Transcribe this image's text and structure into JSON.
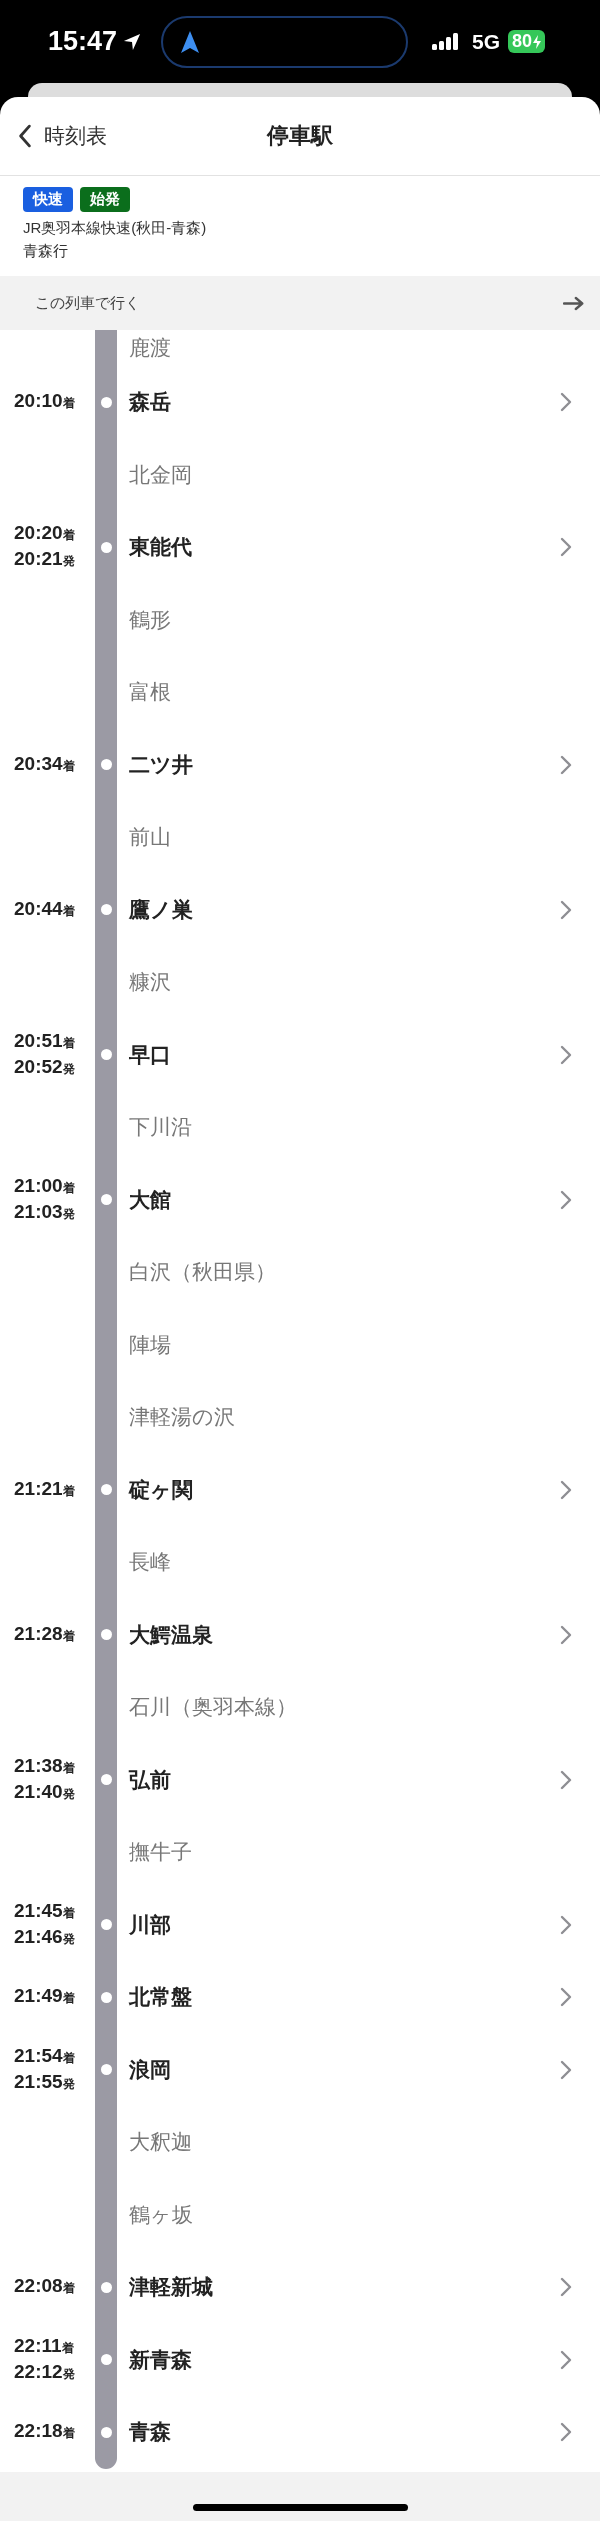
{
  "status_bar": {
    "time": "15:47",
    "network": "5G",
    "battery": "80"
  },
  "header": {
    "back_label": "時刻表",
    "title": "停車駅"
  },
  "train": {
    "badges": [
      {
        "label": "快速",
        "color": "#1a5fe0"
      },
      {
        "label": "始発",
        "color": "#0b6e1c"
      }
    ],
    "line": "JR奥羽本線快速(秋田-青森)",
    "destination": "青森行"
  },
  "ride_button": {
    "label": "この列車で行く"
  },
  "stops": [
    {
      "name": "鹿渡",
      "kind": "pass"
    },
    {
      "name": "森岳",
      "kind": "stop",
      "times": [
        {
          "time": "20:10",
          "type": "着"
        }
      ]
    },
    {
      "name": "北金岡",
      "kind": "pass"
    },
    {
      "name": "東能代",
      "kind": "stop",
      "times": [
        {
          "time": "20:20",
          "type": "着"
        },
        {
          "time": "20:21",
          "type": "発"
        }
      ]
    },
    {
      "name": "鶴形",
      "kind": "pass"
    },
    {
      "name": "富根",
      "kind": "pass"
    },
    {
      "name": "二ツ井",
      "kind": "stop",
      "times": [
        {
          "time": "20:34",
          "type": "着"
        }
      ]
    },
    {
      "name": "前山",
      "kind": "pass"
    },
    {
      "name": "鷹ノ巣",
      "kind": "stop",
      "times": [
        {
          "time": "20:44",
          "type": "着"
        }
      ]
    },
    {
      "name": "糠沢",
      "kind": "pass"
    },
    {
      "name": "早口",
      "kind": "stop",
      "times": [
        {
          "time": "20:51",
          "type": "着"
        },
        {
          "time": "20:52",
          "type": "発"
        }
      ]
    },
    {
      "name": "下川沿",
      "kind": "pass"
    },
    {
      "name": "大館",
      "kind": "stop",
      "times": [
        {
          "time": "21:00",
          "type": "着"
        },
        {
          "time": "21:03",
          "type": "発"
        }
      ]
    },
    {
      "name": "白沢（秋田県）",
      "kind": "pass"
    },
    {
      "name": "陣場",
      "kind": "pass"
    },
    {
      "name": "津軽湯の沢",
      "kind": "pass"
    },
    {
      "name": "碇ヶ関",
      "kind": "stop",
      "times": [
        {
          "time": "21:21",
          "type": "着"
        }
      ]
    },
    {
      "name": "長峰",
      "kind": "pass"
    },
    {
      "name": "大鰐温泉",
      "kind": "stop",
      "times": [
        {
          "time": "21:28",
          "type": "着"
        }
      ]
    },
    {
      "name": "石川（奥羽本線）",
      "kind": "pass"
    },
    {
      "name": "弘前",
      "kind": "stop",
      "times": [
        {
          "time": "21:38",
          "type": "着"
        },
        {
          "time": "21:40",
          "type": "発"
        }
      ]
    },
    {
      "name": "撫牛子",
      "kind": "pass"
    },
    {
      "name": "川部",
      "kind": "stop",
      "times": [
        {
          "time": "21:45",
          "type": "着"
        },
        {
          "time": "21:46",
          "type": "発"
        }
      ]
    },
    {
      "name": "北常盤",
      "kind": "stop",
      "times": [
        {
          "time": "21:49",
          "type": "着"
        }
      ]
    },
    {
      "name": "浪岡",
      "kind": "stop",
      "times": [
        {
          "time": "21:54",
          "type": "着"
        },
        {
          "time": "21:55",
          "type": "発"
        }
      ]
    },
    {
      "name": "大釈迦",
      "kind": "pass"
    },
    {
      "name": "鶴ヶ坂",
      "kind": "pass"
    },
    {
      "name": "津軽新城",
      "kind": "stop",
      "times": [
        {
          "time": "22:08",
          "type": "着"
        }
      ]
    },
    {
      "name": "新青森",
      "kind": "stop",
      "times": [
        {
          "time": "22:11",
          "type": "着"
        },
        {
          "time": "22:12",
          "type": "発"
        }
      ]
    },
    {
      "name": "青森",
      "kind": "stop",
      "times": [
        {
          "time": "22:18",
          "type": "着"
        }
      ]
    }
  ]
}
